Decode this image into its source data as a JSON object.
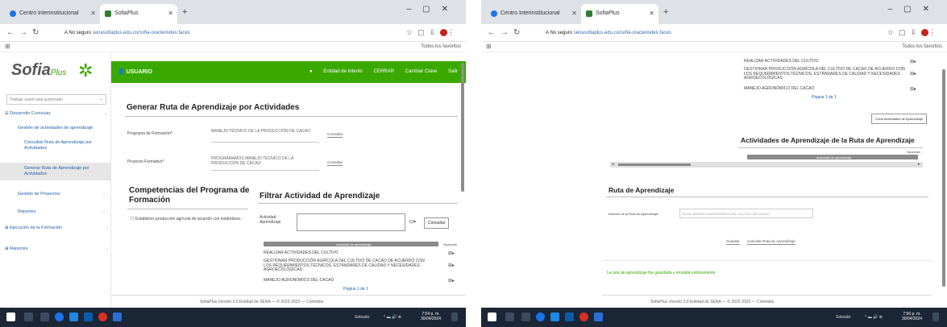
{
  "left": {
    "browser": {
      "tabs": [
        {
          "label": "Centro Interinstitucional",
          "active": false
        },
        {
          "label": "SofiaPlus",
          "active": true
        }
      ],
      "url_prefix": "A No seguro",
      "url": "senasofiaplus.edu.co/sofia-oracle/index.faces",
      "bookmarks_label": "Todos los favoritos"
    },
    "sidebar": {
      "logo_text": "Sofia",
      "logo_plus": "Plus",
      "role_placeholder": "Trabaje usted está autorizado",
      "items": [
        {
          "label": "Desarrollo Curricular",
          "level": 0
        },
        {
          "label": "Gestión de actividades de aprendizaje",
          "level": 1
        },
        {
          "label": "Consultar Ruta de Aprendizaje por Actividades",
          "level": 2
        },
        {
          "label": "Generar Ruta de Aprendizaje por Actividades",
          "level": 2,
          "active": true
        },
        {
          "label": "Gestión de Proyectos",
          "level": 1
        },
        {
          "label": "Reportes",
          "level": 1
        },
        {
          "label": "Ejecución de la Formación",
          "level": 0
        },
        {
          "label": "Reportes",
          "level": 0
        }
      ]
    },
    "topbar": {
      "user": "USUARIO",
      "menu": [
        "Entidad de Interés",
        "CERRAR",
        "Cambiar Clave",
        "Salir"
      ]
    },
    "main": {
      "title": "Generar Ruta de Aprendizaje por Actividades",
      "program_label": "Programa de Formación*",
      "program_value": "MANEJO TÉCNICO DE LA PRODUCCIÓN DE CACAO",
      "project_label": "Proyecto Formativo*",
      "project_value": "PROGRAMAMOS MANEJO TÉCNICO DE LA PRODUCCIÓN DE CACAO",
      "consult_label": "Consultar",
      "competencias_title": "Competencias del Programa de Formación",
      "competencia_item": "Establecer producción agrícola de acuerdo con estándares",
      "filtrar_title": "Filtrar Actividad de Aprendizaje",
      "actividad_label": "Actividad Aprendizaje",
      "filter_button": "Consultar",
      "table_header": "Actividad de aprendizaje",
      "table_header_right": "Opciones",
      "rows": [
        "REALIZAR ACTIVIDADES DEL CULTIVO",
        "GESTIONAR PRODUCCIÓN AGRÍCOLA DEL CULTIVO DE CACAO DE ACUERDO CON LOS REQUERIMIENTOS TÉCNICOS, ESTÁNDARES DE CALIDAD Y NECESIDADES AGROECOLÓGICAS",
        "MANEJO AGRONÓMICO DEL CACAO"
      ],
      "pager": "Página 1 de 1",
      "footer": "SofiaPlus Versión 3.0 Entidad de SENA — © 2022-2023 — Colombia"
    },
    "taskbar": {
      "weather": "Soleado",
      "time": "7:54 p. m.",
      "date": "30/04/2024"
    }
  },
  "right": {
    "browser": {
      "tabs": [
        {
          "label": "Centro Interinstitucional",
          "active": false
        },
        {
          "label": "SofiaPlus",
          "active": true
        }
      ],
      "url_prefix": "A No seguro",
      "url": "senasofiaplus.edu.co/sofia-oracle/index.faces",
      "bookmarks_label": "Todos los favoritos"
    },
    "main": {
      "rows": [
        "REALIZAR ACTIVIDADES DEL CULTIVO",
        "GESTIONAR PRODUCCIÓN AGRÍCOLA DEL CULTIVO DE CACAO DE ACUERDO CON LOS REQUERIMIENTOS TÉCNICOS, ESTÁNDARES DE CALIDAD Y NECESIDADES AGROECOLÓGICAS",
        "MANEJO AGRONÓMICO DEL CACAO"
      ],
      "pager": "Página 1 de 1",
      "add_button": "Crear Actividades de Aprendizaje",
      "activities_title": "Actividades de Aprendizaje de la Ruta de Aprendizaje",
      "activities_header": "Actividad de aprendizaje",
      "activities_header_right": "Opciones",
      "ruta_title": "Ruta de Aprendizaje",
      "ruta_label": "Nombre de la Ruta de Aprendizaje*",
      "ruta_value": "RUTA: MANEJO AGRONÓMICO DEL CULTIVO DE CACAO",
      "save_button": "Guardar",
      "cancel_button": "Cancelar Ruta de Aprendizaje",
      "success": "La ruta de aprendizaje fue guardada y enviada exitosamente",
      "footer": "SofiaPlus Versión 3.0 Entidad de SENA — © 2022-2023 — Colombia"
    },
    "taskbar": {
      "weather": "Soleado",
      "time": "7:56 p. m.",
      "date": "30/04/2024"
    }
  },
  "colors": {
    "brand_green": "#39a900",
    "link_blue": "#1f5fa6",
    "taskbar": "#1b2636"
  },
  "icons": [
    "search-icon",
    "reload-icon",
    "back-icon",
    "forward-icon",
    "star-icon",
    "profile-icon",
    "windows-start-icon",
    "chrome-icon",
    "edit-icon",
    "trash-icon"
  ]
}
